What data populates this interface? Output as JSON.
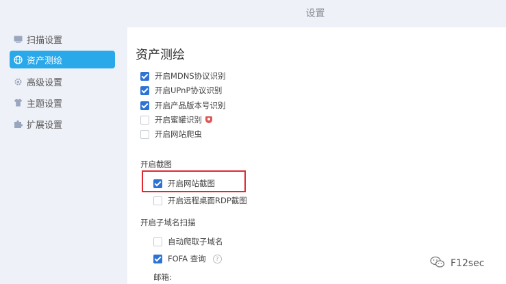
{
  "window": {
    "title": "设置"
  },
  "sidebar": {
    "items": [
      {
        "label": "扫描设置",
        "icon": "scan-icon",
        "active": false
      },
      {
        "label": "资产测绘",
        "icon": "globe-icon",
        "active": true
      },
      {
        "label": "高级设置",
        "icon": "gear-icon",
        "active": false
      },
      {
        "label": "主题设置",
        "icon": "shirt-icon",
        "active": false
      },
      {
        "label": "扩展设置",
        "icon": "puzzle-icon",
        "active": false
      }
    ]
  },
  "main": {
    "title": "资产测绘",
    "options": [
      {
        "label": "开启MDNS协议识别",
        "checked": true
      },
      {
        "label": "开启UPnP协议识别",
        "checked": true
      },
      {
        "label": "开启产品版本号识别",
        "checked": true
      },
      {
        "label": "开启蜜罐识别",
        "checked": false,
        "badge": "pro-badge-icon"
      },
      {
        "label": "开启网站爬虫",
        "checked": false
      }
    ],
    "screenshot_group": {
      "label": "开启截图",
      "options": [
        {
          "label": "开启网站截图",
          "checked": true
        },
        {
          "label": "开启远程桌面RDP截图",
          "checked": false
        }
      ]
    },
    "subdomain_group": {
      "label": "开启子域名扫描",
      "options": [
        {
          "label": "自动爬取子域名",
          "checked": false
        },
        {
          "label": "FOFA 查询",
          "checked": true,
          "help": "?"
        }
      ],
      "email_label": "邮箱:"
    }
  },
  "watermark": {
    "text": "F12sec"
  },
  "colors": {
    "accent": "#29a8ea",
    "checkbox": "#2d73d6",
    "highlight": "#e0282e"
  }
}
